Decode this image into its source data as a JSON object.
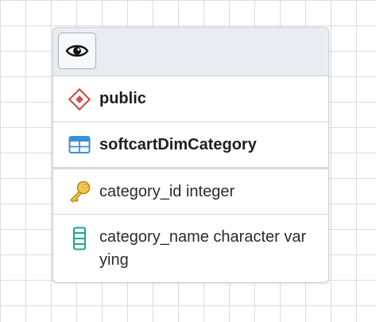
{
  "header": {
    "eye_icon": "eye-icon"
  },
  "schema": {
    "icon": "schema-diamond-icon",
    "label": "public",
    "color": "#c9534f"
  },
  "table": {
    "icon": "table-grid-icon",
    "label": "softcartDimCategory",
    "color": "#3d8fd6"
  },
  "columns": [
    {
      "icon": "key-icon",
      "label": "category_id integer",
      "color": "#e0b62c"
    },
    {
      "icon": "column-icon",
      "label": "category_name character varying",
      "color": "#1ea787"
    }
  ],
  "colors": {
    "grid": "#d9dce3",
    "header_bg": "#e9ecf1",
    "border": "#c9ced8"
  }
}
